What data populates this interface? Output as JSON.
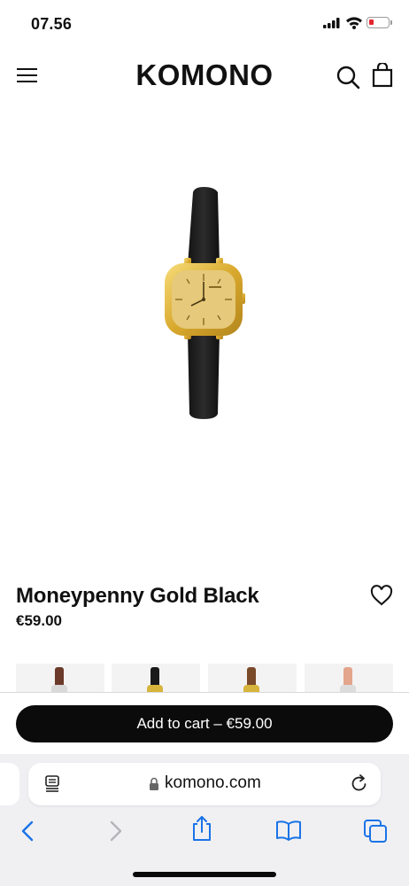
{
  "status_bar": {
    "time": "07.56"
  },
  "header": {
    "logo": "KOMONO"
  },
  "product": {
    "title": "Moneypenny Gold Black",
    "price": "€59.00"
  },
  "thumbnails": [
    {
      "strap_color": "#6b3a2a",
      "case_color": "#d9d9d9"
    },
    {
      "strap_color": "#1a1a1a",
      "case_color": "#d7b43c"
    },
    {
      "strap_color": "#7a4a2a",
      "case_color": "#d7b43c"
    },
    {
      "strap_color": "#e3a58c",
      "case_color": "#dcdcdc"
    }
  ],
  "cart": {
    "button_label": "Add to cart – €59.00"
  },
  "browser": {
    "url": "komono.com"
  },
  "colors": {
    "accent_button": "#0b0b0b",
    "battery_low": "#e2262f",
    "ios_blue": "#1a73e8"
  },
  "icons": [
    "menu-icon",
    "search-icon",
    "bag-icon",
    "heart-icon",
    "reader-icon",
    "lock-icon",
    "reload-icon",
    "back-icon",
    "forward-icon",
    "share-icon",
    "bookmarks-icon",
    "tabs-icon"
  ]
}
